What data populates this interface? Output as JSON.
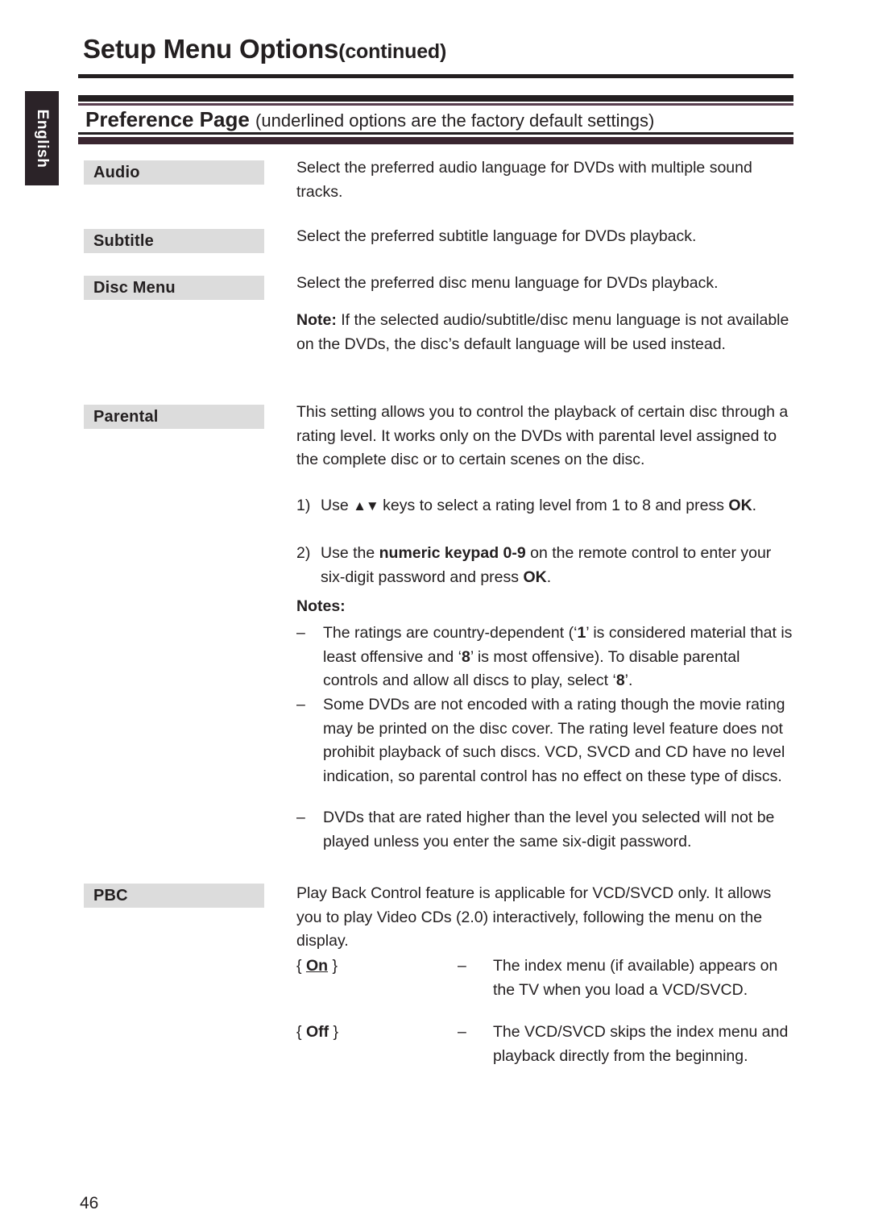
{
  "sidebar": {
    "language_tab": "English"
  },
  "header": {
    "title": "Setup Menu Options",
    "title_suffix": "(continued)",
    "section_title": "Preference Page",
    "section_subtitle": "(underlined options are the factory default settings)"
  },
  "rows": {
    "audio": {
      "label": "Audio",
      "description": "Select the preferred audio language for DVDs with multiple sound tracks."
    },
    "subtitle": {
      "label": "Subtitle",
      "description": "Select the preferred subtitle language for DVDs playback."
    },
    "disc_menu": {
      "label": "Disc Menu",
      "description": "Select the preferred disc menu language for DVDs playback.",
      "note_label": "Note:",
      "note_text": "If the selected audio/subtitle/disc menu language is not available on the DVDs, the disc’s default language will be used instead."
    },
    "parental": {
      "label": "Parental",
      "description": "This setting allows you to control the playback of certain disc through a rating level. It works only on the DVDs with parental level assigned to the complete disc or to certain scenes on the disc.",
      "step1_marker": "1)",
      "step1_a": "Use ",
      "step1_arrows": "▲▼",
      "step1_b": " keys to select a rating level from 1 to 8 and press ",
      "step1_ok": "OK",
      "step1_c": ".",
      "step2_marker": "2)",
      "step2_a": "Use the ",
      "step2_bold": "numeric keypad 0-9",
      "step2_b": " on the remote control to enter your six-digit password and press ",
      "step2_ok": "OK",
      "step2_c": ".",
      "notes_label": "Notes:",
      "note_marker": "–",
      "note1_a": "The ratings are country-dependent (‘",
      "note1_b1": "1",
      "note1_c": "’ is considered material that is least offensive and ‘",
      "note1_b2": "8",
      "note1_d": "’ is most offensive). To disable parental controls and allow all discs to play, select ‘",
      "note1_b3": "8",
      "note1_e": "’.",
      "note2": "Some DVDs are not encoded with a rating though the movie rating may be printed on the disc cover. The rating level feature does not prohibit playback of such discs. VCD, SVCD and CD have no level indication, so parental control has no effect on these type of discs.",
      "note3": "DVDs that are rated higher than the level you selected will not be played unless you enter the same six-digit password."
    },
    "pbc": {
      "label": "PBC",
      "description": "Play Back Control feature is applicable for VCD/SVCD only. It allows you to play Video CDs (2.0) interactively, following the menu on the display.",
      "options": [
        {
          "open_brace": "{ ",
          "value": "On",
          "close_brace": " }",
          "underlined": true,
          "dash": "–",
          "description": "The index menu (if available) appears on the TV when you load a VCD/SVCD."
        },
        {
          "open_brace": "{ ",
          "value": "Off",
          "close_brace": " }",
          "underlined": false,
          "dash": "–",
          "description": "The VCD/SVCD skips the index menu and playback directly from the beginning."
        }
      ]
    }
  },
  "footer": {
    "page_number": "46"
  },
  "colors": {
    "label_box_background": "#dcdcdc",
    "tab_background": "#2b2328",
    "text": "#231f20",
    "accent_rule": "#5a3f50"
  }
}
